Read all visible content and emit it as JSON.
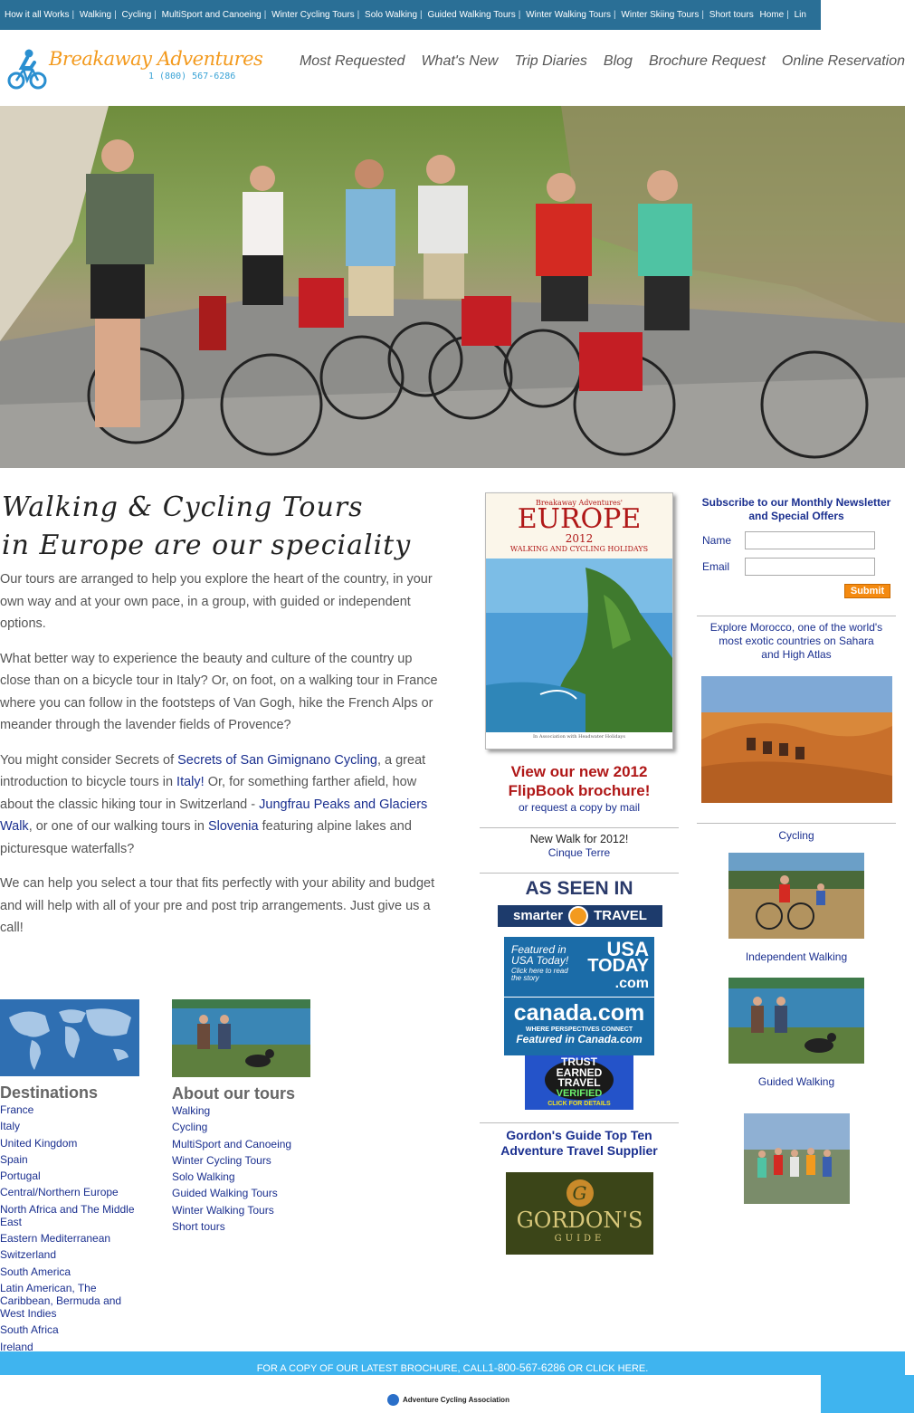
{
  "topnav": {
    "items": [
      "How it all Works",
      "Walking",
      "Cycling",
      "MultiSport and Canoeing",
      "Winter Cycling Tours",
      "Solo Walking",
      "Guided Walking Tours",
      "Winter Walking Tours",
      "Winter Skiing Tours",
      "Short tours",
      "Home",
      "Lin"
    ]
  },
  "header": {
    "brand": "Breakaway Adventures",
    "phone": "1 (800) 567-6286",
    "nav": [
      "Most Requested",
      "What's New",
      "Trip Diaries",
      "Blog",
      "Brochure Request",
      "Online Reservation"
    ]
  },
  "intro": {
    "title_line1": "Walking & Cycling Tours",
    "title_line2": "in Europe are our speciality",
    "p1": "Our tours are arranged to help you explore the heart of the country, in your own way and at your own pace, in a group, with guided or independent options.",
    "p2": "What better way to experience the beauty and culture of the country up close than on a bicycle tour in Italy? Or, on foot, on a walking tour in France where you can follow in the footsteps of Van Gogh, hike the French Alps or meander through the lavender fields of Provence?",
    "p3_a": "You might consider Secrets of ",
    "p3_link1": "Secrets of San Gimignano Cycling",
    "p3_b": ", a great introduction to bicycle tours in ",
    "p3_link2": "Italy!",
    "p3_c": " Or, for something farther afield, how about the classic hiking tour in Switzerland - ",
    "p3_link3": "Jungfrau Peaks and Glaciers Walk",
    "p3_d": ", or one of our walking tours in ",
    "p3_link4": "Slovenia",
    "p3_e": " featuring alpine lakes and picturesque waterfalls?",
    "p4": "We can help you select a tour that fits perfectly with your ability and budget and will help with all of your pre and post trip arrangements. Just give us a call!"
  },
  "destinations": {
    "heading": "Destinations",
    "items": [
      "France",
      "Italy",
      "United Kingdom",
      "Spain",
      "Portugal",
      "Central/Northern Europe",
      "North Africa and The Middle East",
      "Eastern Mediterranean",
      "Switzerland",
      "South America",
      "Latin American, The Caribbean, Bermuda and West Indies",
      "South Africa",
      "Ireland"
    ]
  },
  "about": {
    "heading": "About our tours",
    "items": [
      "Walking",
      "Cycling",
      "MultiSport and Canoeing",
      "Winter Cycling Tours",
      "Solo Walking",
      "Guided Walking Tours",
      "Winter Walking Tours",
      "Short tours"
    ]
  },
  "brochure": {
    "cover_top": "Breakaway Adventures'",
    "cover_title": "Europe",
    "cover_year": "2012",
    "cover_sub": "Walking and Cycling Holidays",
    "cover_assoc": "In Association with Headwater Holidays",
    "headline_1": "View our new 2012",
    "headline_2": "FlipBook brochure!",
    "request": "or request a copy by mail",
    "new_walk": "New Walk for 2012!",
    "new_walk_link": "Cinque Terre"
  },
  "seen_in": {
    "heading": "AS SEEN IN",
    "smarter_a": "smarter",
    "smarter_b": "TRAVEL",
    "usa_featured": "Featured in USA Today!",
    "usa_click": "Click here to read the story",
    "usa_logo_1": "USA",
    "usa_logo_2": "TODAY",
    "usa_logo_3": ".com",
    "canada_logo": "canada.com",
    "canada_tag": "WHERE PERSPECTIVES CONNECT",
    "canada_featured": "Featured in Canada.com",
    "trust_1": "TRUST",
    "trust_2": "EARNED",
    "trust_3": "TRAVEL",
    "trust_4": "VERIFIED",
    "trust_5": "CLICK FOR DETAILS"
  },
  "gordons": {
    "heading_1": "Gordon's Guide Top Ten",
    "heading_2": "Adventure Travel Supplier",
    "logo_main": "GORDON'S",
    "logo_sub": "GUIDE",
    "logo_g": "G"
  },
  "newsletter": {
    "heading_1": "Subscribe to our Monthly Newsletter",
    "heading_2": "and Special Offers",
    "name_label": "Name",
    "email_label": "Email",
    "name_value": "",
    "email_value": "",
    "submit": "Submit"
  },
  "right": {
    "morocco": "Explore Morocco, one of the world's most exotic countries on Sahara and High Atlas",
    "cycling": "Cycling",
    "independent": "Independent Walking",
    "guided": "Guided Walking"
  },
  "footer": {
    "text_a": "FOR A COPY OF OUR LATEST BROCHURE, CALL",
    "phone": "1-800-567-6286",
    "text_b": "OR CLICK HERE.",
    "assoc": "Adventure Cycling Association"
  },
  "colors": {
    "topnav_bg": "#2a6f96",
    "brand_orange": "#f39a1e",
    "link_blue": "#1a2f8f",
    "brochure_red": "#b01818",
    "footer_blue": "#3fb4ef",
    "submit_orange": "#f48a10"
  }
}
